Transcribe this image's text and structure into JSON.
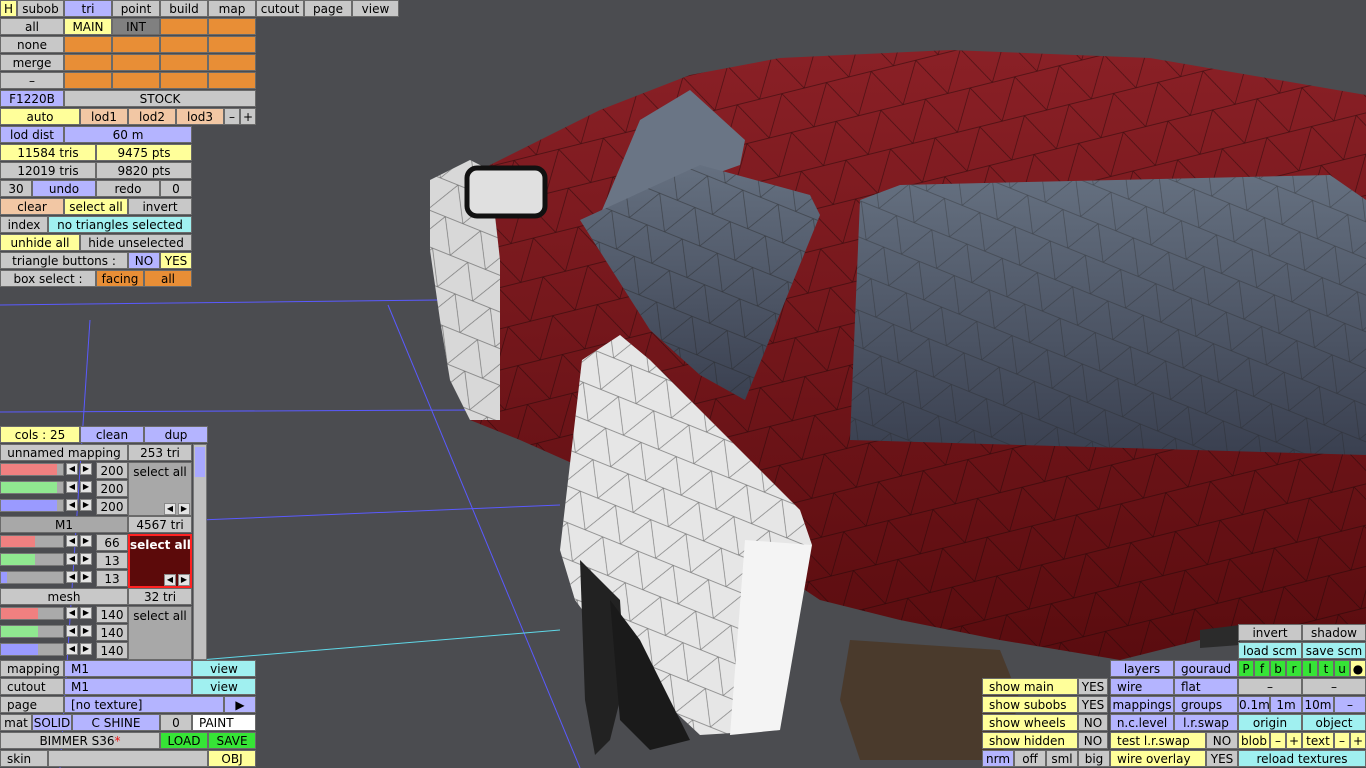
{
  "topbar": {
    "h": "H",
    "tabs": [
      "subob",
      "tri",
      "point",
      "build",
      "map",
      "cutout",
      "page",
      "view"
    ]
  },
  "sel": {
    "all": "all",
    "none": "none",
    "merge": "merge",
    "dash": "–",
    "main": "MAIN",
    "int": "INT"
  },
  "model": {
    "code": "F1220B",
    "variant": "STOCK",
    "auto": "auto",
    "lod1": "lod1",
    "lod2": "lod2",
    "lod3": "lod3",
    "minus": "–",
    "plus": "+",
    "lod_dist_label": "lod dist",
    "lod_dist_value": "60 m",
    "tris1": "11584 tris",
    "pts1": "9475 pts",
    "tris2": "12019 tris",
    "pts2": "9820 pts",
    "num30": "30",
    "undo": "undo",
    "redo": "redo",
    "num0": "0"
  },
  "tri_panel": {
    "clear": "clear",
    "select_all": "select all",
    "invert": "invert",
    "index": "index",
    "status": "no triangles selected",
    "unhide_all": "unhide all",
    "hide_unselected": "hide unselected",
    "tri_buttons_label": "triangle buttons :",
    "no": "NO",
    "yes": "YES",
    "box_select_label": "box select :",
    "facing": "facing",
    "box_all": "all"
  },
  "mapping_panel": {
    "cols": "cols : 25",
    "clean": "clean",
    "dup": "dup",
    "map1": {
      "name": "unnamed mapping",
      "tri": "253 tri",
      "v1": "200",
      "v2": "200",
      "v3": "200",
      "select": "select all"
    },
    "map2": {
      "name": "M1",
      "tri": "4567 tri",
      "v1": "66",
      "v2": "13",
      "v3": "13",
      "select": "select all"
    },
    "map3": {
      "name": "mesh",
      "tri": "32 tri",
      "v1": "140",
      "v2": "140",
      "v3": "140",
      "select": "select all"
    }
  },
  "props": {
    "mapping_label": "mapping",
    "mapping_value": "M1",
    "mapping_view": "view",
    "cutout_label": "cutout",
    "cutout_value": "M1",
    "cutout_view": "view",
    "page_label": "page",
    "page_value": "[no texture]",
    "page_arrow": "▶",
    "mat": "mat",
    "solid": "SOLID",
    "cshine": "C SHINE",
    "zero": "0",
    "paint": "PAINT",
    "car_name": "BIMMER S36",
    "star": "*",
    "load": "LOAD",
    "save": "SAVE",
    "skin": "skin",
    "obj": "OBJ"
  },
  "right_panel": {
    "invert": "invert",
    "shadow": "shadow",
    "load_scm": "load scm",
    "save_scm": "save scm",
    "flags": [
      "P",
      "f",
      "b",
      "r",
      "l",
      "t",
      "u",
      "●"
    ],
    "dash": "–",
    "layers": "layers",
    "gouraud": "gouraud",
    "wire": "wire",
    "flat": "flat",
    "mappings": "mappings",
    "groups": "groups",
    "d01": "0.1m",
    "d1": "1m",
    "d10": "10m",
    "nclevel": "n.c.level",
    "lrswap": "l.r.swap",
    "origin": "origin",
    "object": "object",
    "test_lr_swap": "test l.r.swap",
    "test_no": "NO",
    "blob": "blob",
    "text": "text",
    "wire_overlay": "wire overlay",
    "wo_yes": "YES",
    "reload": "reload textures",
    "nrm": "nrm",
    "off": "off",
    "sml": "sml",
    "big": "big"
  },
  "show_panel": {
    "show_main": "show main",
    "main_val": "YES",
    "show_subobs": "show subobs",
    "subobs_val": "YES",
    "show_wheels": "show wheels",
    "wheels_val": "NO",
    "show_hidden": "show hidden",
    "hidden_val": "NO"
  },
  "colors": {
    "background": "#4b4c50",
    "car_body": "#7a1518",
    "panel_white": "#e6e6e6",
    "grid": "#5a5aff"
  }
}
